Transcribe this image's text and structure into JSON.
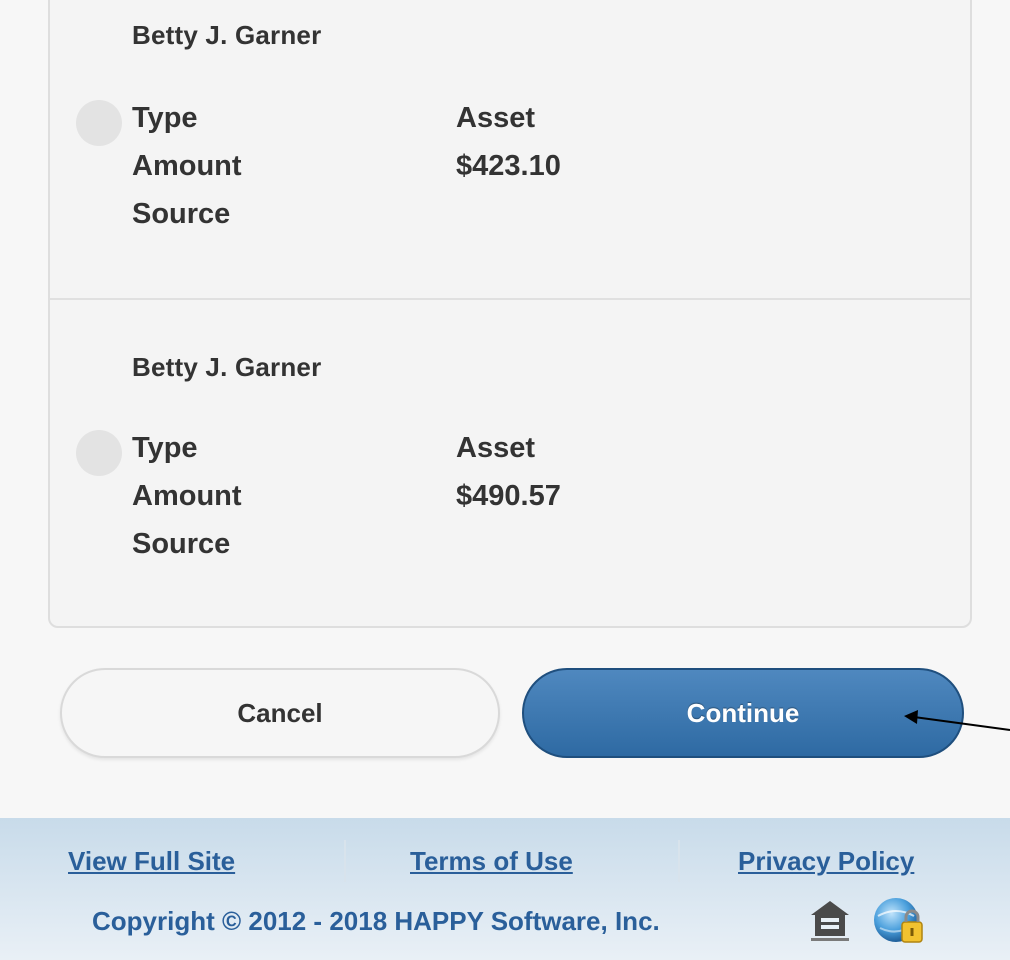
{
  "entries": [
    {
      "name": "Betty J. Garner",
      "type_label": "Type",
      "type_value": "Asset",
      "amount_label": "Amount",
      "amount_value": "$423.10",
      "source_label": "Source",
      "selected": false
    },
    {
      "name": "Betty J. Garner",
      "type_label": "Type",
      "type_value": "Asset",
      "amount_label": "Amount",
      "amount_value": "$490.57",
      "source_label": "Source",
      "selected": false
    }
  ],
  "actions": {
    "cancel_label": "Cancel",
    "continue_label": "Continue"
  },
  "footer": {
    "links": {
      "view_full_site": "View Full Site",
      "terms_of_use": "Terms of Use",
      "privacy_policy": "Privacy Policy"
    },
    "copyright": "Copyright © 2012 - 2018 HAPPY Software, Inc.",
    "icons": [
      "equal-housing-icon",
      "security-lock-icon"
    ]
  },
  "colors": {
    "primary_button": "#2e6aa3",
    "link": "#2a5f9a",
    "footer_bg": "#c8dbea"
  }
}
